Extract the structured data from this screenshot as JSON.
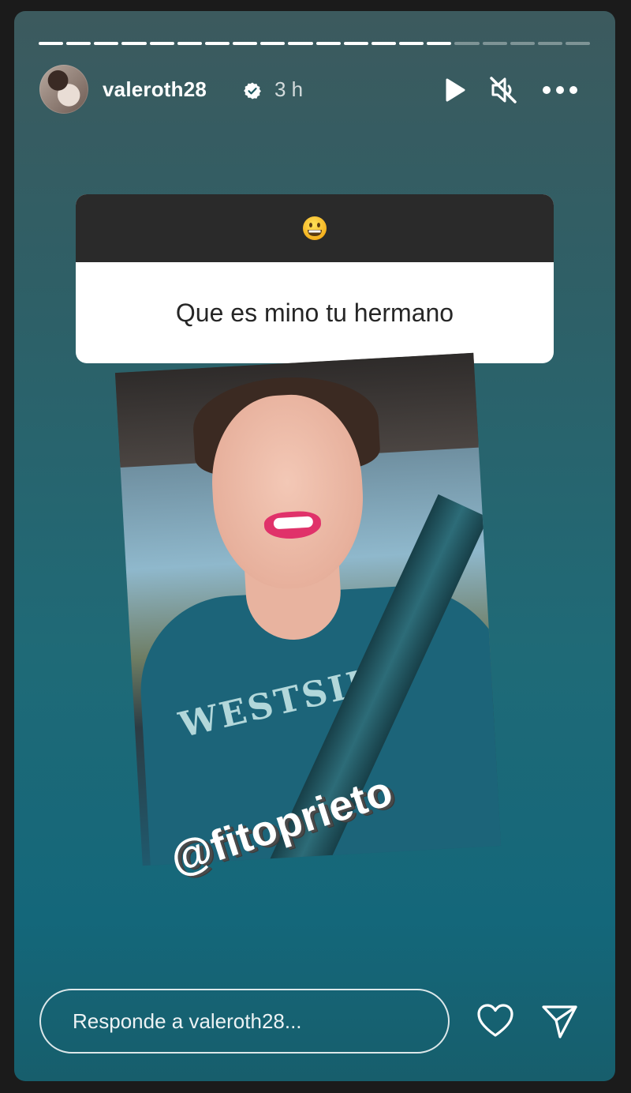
{
  "story": {
    "progress": {
      "total_segments": 20,
      "completed_segments": 15
    },
    "user": {
      "username": "valeroth28",
      "time_ago": "3 h",
      "verified": true,
      "avatar_icon": "avatar"
    },
    "controls": {
      "play_icon": "play-icon",
      "mute_icon": "speaker-muted-icon",
      "more_icon": "more-options-icon"
    },
    "question_sticker": {
      "emoji": "grinning-face",
      "text": "Que es mino tu hermano"
    },
    "mention_sticker": {
      "text": "@fitoprieto"
    },
    "photo_text": {
      "shirt_print": "WESTSIDE"
    },
    "reply": {
      "placeholder": "Responde a valeroth28...",
      "like_icon": "heart-icon",
      "share_icon": "send-icon"
    },
    "colors": {
      "background_top": "#3c5a5e",
      "background_bottom": "#14677a",
      "sticker_header": "#2a2a2a"
    }
  }
}
